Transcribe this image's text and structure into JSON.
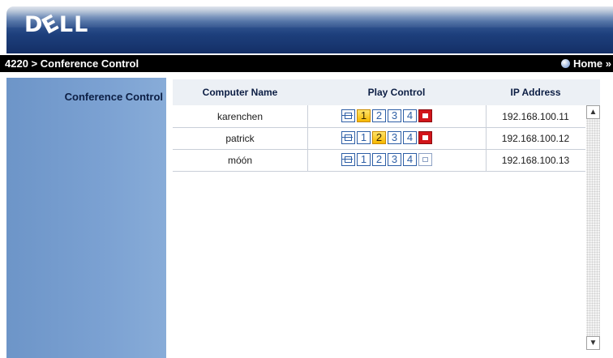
{
  "header": {
    "logo_text": "DELL"
  },
  "nav": {
    "breadcrumb": "4220 > Conference Control",
    "home_label": "Home »"
  },
  "sidebar": {
    "items": [
      {
        "label": "Conference Control"
      }
    ]
  },
  "table": {
    "columns": [
      "Computer Name",
      "Play Control",
      "IP Address"
    ],
    "control_buttons": [
      "fullscreen",
      "1",
      "2",
      "3",
      "4",
      "stop"
    ],
    "rows": [
      {
        "name": "karenchen",
        "active_quadrant": "1",
        "stop_active": true,
        "ip": "192.168.100.11"
      },
      {
        "name": "patrick",
        "active_quadrant": "2",
        "stop_active": true,
        "ip": "192.168.100.12"
      },
      {
        "name": "móón",
        "active_quadrant": null,
        "stop_active": false,
        "ip": "192.168.100.13"
      }
    ]
  },
  "colors": {
    "accent": "#2e5fa6",
    "active_yellow": "#f6b800",
    "stop_red": "#d2151a",
    "sidebar_blue": "#7ba1d2",
    "header_blue": "#1d3f7c"
  }
}
